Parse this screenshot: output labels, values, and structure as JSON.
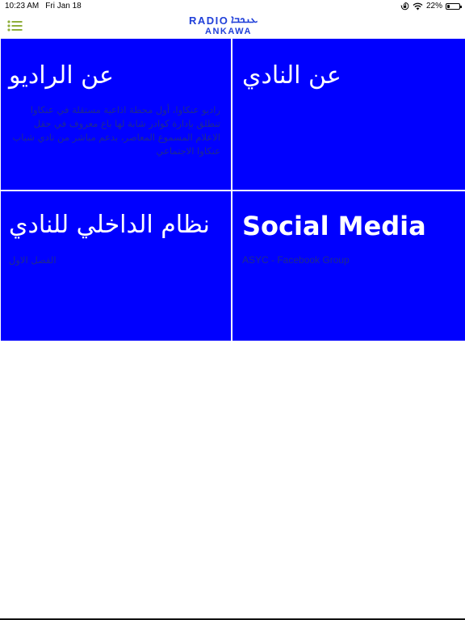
{
  "status_bar": {
    "time": "10:23 AM",
    "date": "Fri Jan 18",
    "battery": "22%",
    "battery_level": 0.22
  },
  "header": {
    "logo_top": "RADIO",
    "logo_script": "ܥܢܟܒܐ",
    "logo_bottom": "ANKAWA",
    "menu_icon": "list-icon",
    "accent_color": "#8fae3a",
    "brand_color": "#1f3fd9"
  },
  "tiles": [
    {
      "title": "عن الراديو",
      "description": "راديو عنكاوا، أول محطة اذاعية مستقلة في عنكاوا تنطلق بإدارة كوادر شابة لها باع معروف في حقل الاعلام المسموع المعاصر، بدعم مباشر من نادي شباب عنكاوا الاجتماعي"
    },
    {
      "title": "عن النادي",
      "description": ""
    },
    {
      "title": "نظام الداخلي للنادي",
      "description": "الفصل الاول"
    },
    {
      "title": "Social Media",
      "description": "ASYC - Facebook Group"
    }
  ],
  "colors": {
    "tile_background": "#0000ff",
    "tile_title": "#ffffff",
    "tile_description": "#1e2a8f"
  }
}
